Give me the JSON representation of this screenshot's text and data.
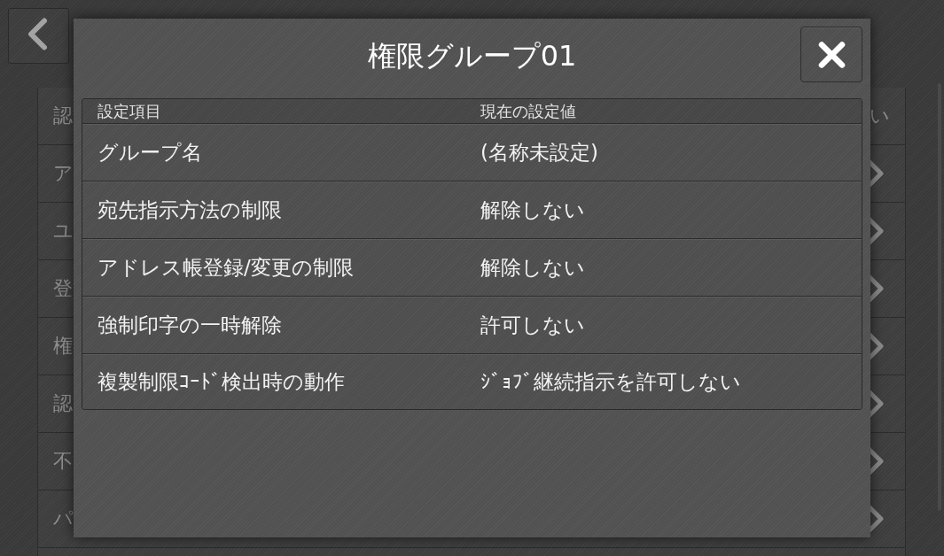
{
  "background_list": {
    "items": [
      {
        "label": "認",
        "kind": "value",
        "value": "い"
      },
      {
        "label": "ア",
        "kind": "link"
      },
      {
        "label": "ユ",
        "kind": "link"
      },
      {
        "label": "登",
        "kind": "link"
      },
      {
        "label": "権",
        "kind": "link"
      },
      {
        "label": "認",
        "kind": "link"
      },
      {
        "label": "不",
        "kind": "link"
      },
      {
        "label": "パ",
        "kind": "link"
      }
    ]
  },
  "dialog": {
    "title": "権限グループ01",
    "table": {
      "columns": [
        "設定項目",
        "現在の設定値"
      ],
      "rows": [
        {
          "item": "グループ名",
          "value": "(名称未設定)"
        },
        {
          "item": "宛先指示方法の制限",
          "value": "解除しない"
        },
        {
          "item": "アドレス帳登録/変更の制限",
          "value": "解除しない"
        },
        {
          "item": "強制印字の一時解除",
          "value": "許可しない"
        },
        {
          "item": "複製制限ｺｰﾄﾞ検出時の動作",
          "value": "ｼﾞｮﾌﾞ継続指示を許可しない"
        }
      ]
    }
  }
}
